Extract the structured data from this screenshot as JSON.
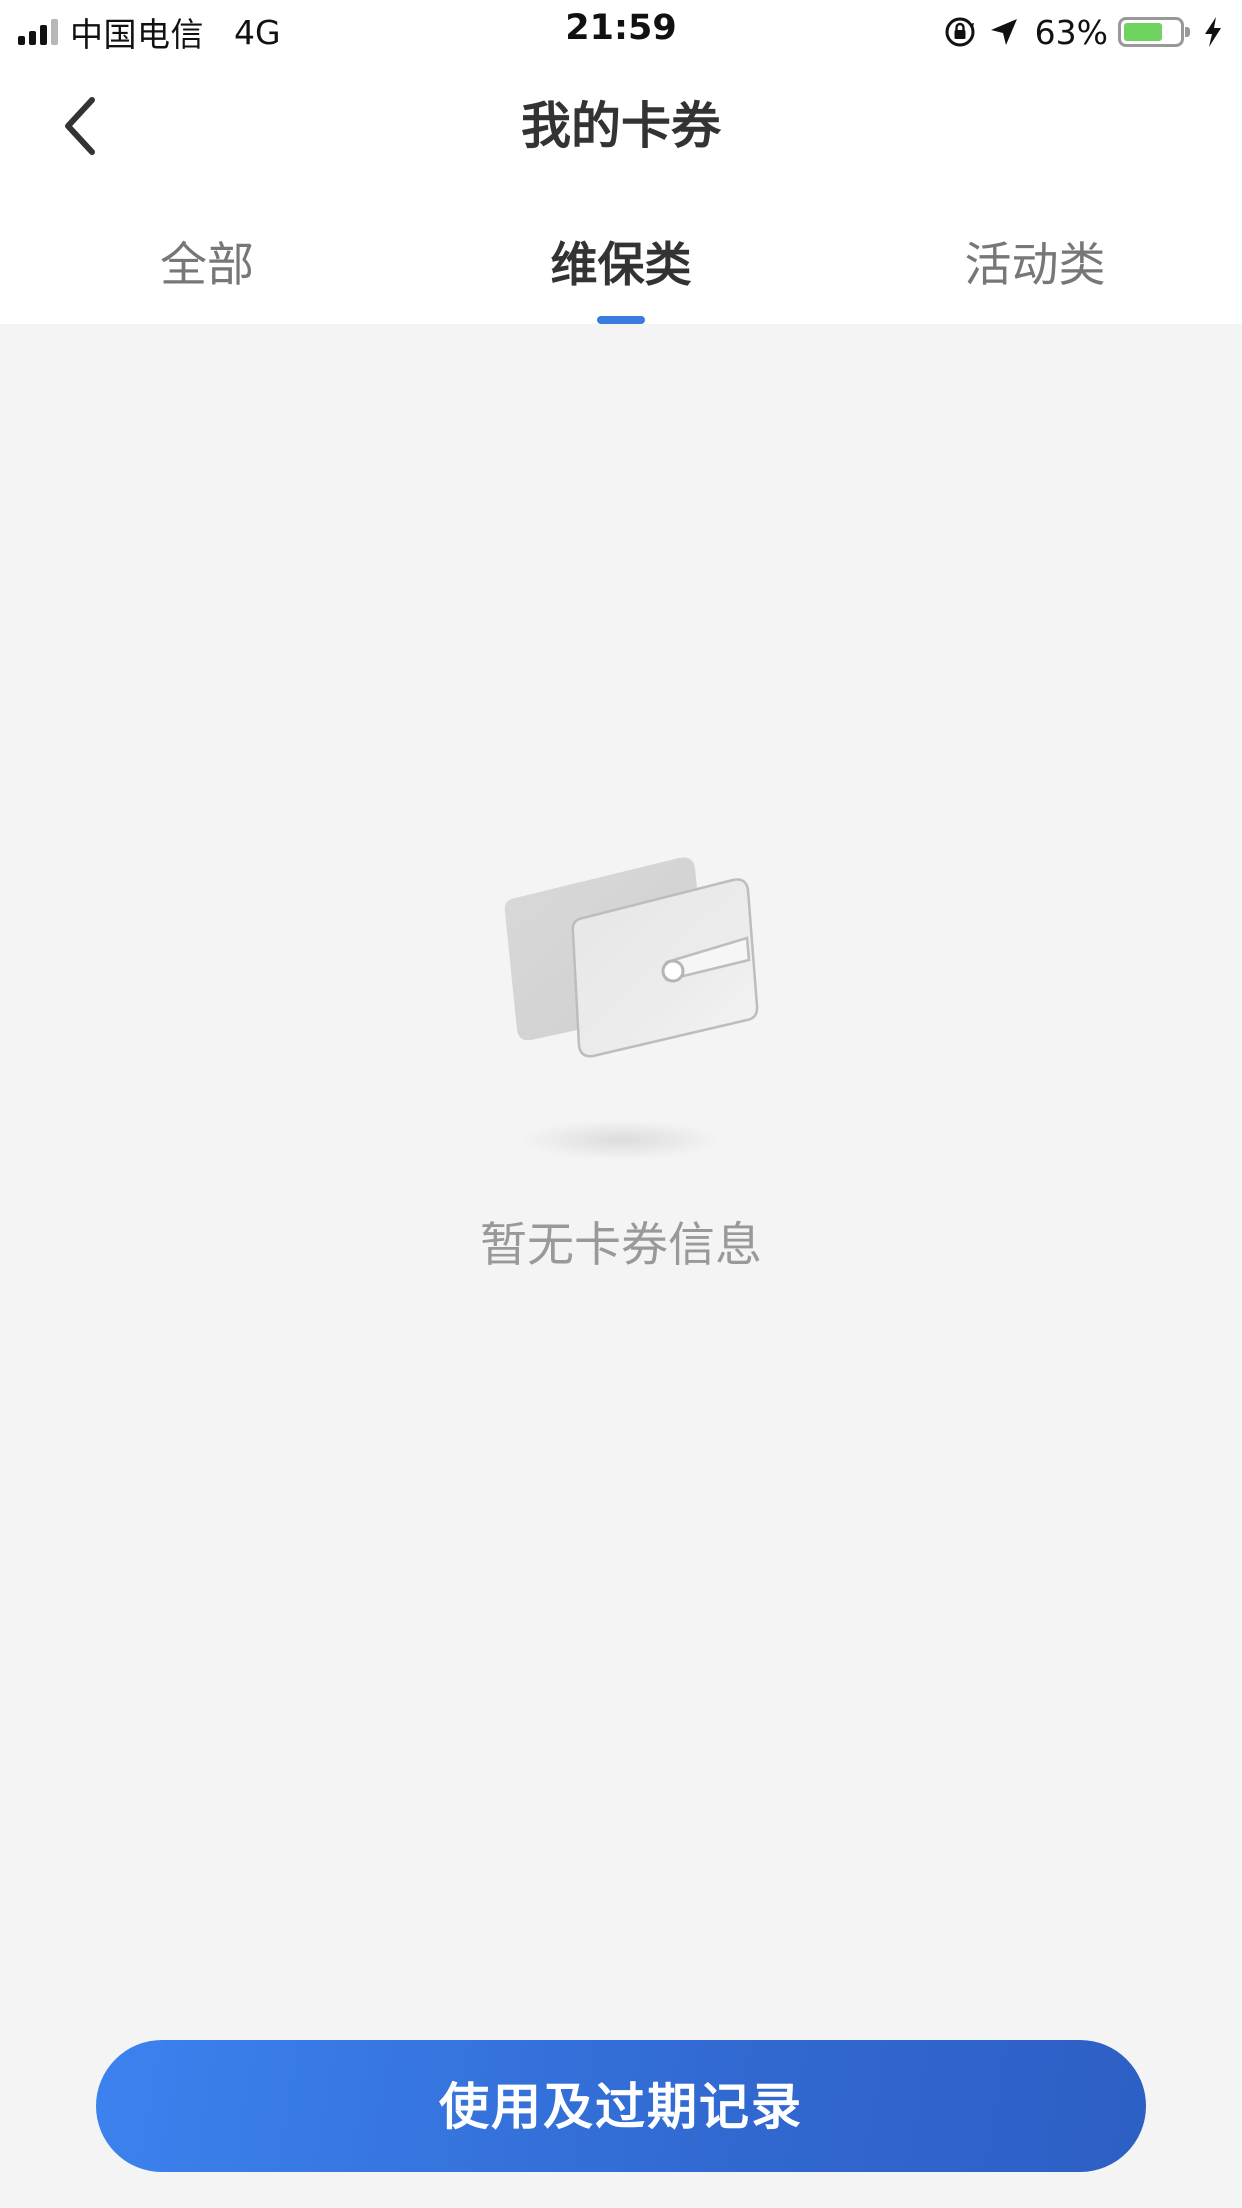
{
  "status_bar": {
    "carrier": "中国电信",
    "network": "4G",
    "time": "21:59",
    "battery_percent": "63%",
    "battery_color": "#6fd35f"
  },
  "nav": {
    "title": "我的卡券",
    "back_icon": "chevron-left-icon"
  },
  "tabs": {
    "items": [
      {
        "label": "全部"
      },
      {
        "label": "维保类"
      },
      {
        "label": "活动类"
      }
    ],
    "active_index": 1,
    "accent_color": "#3a7be0"
  },
  "empty_state": {
    "icon": "wallet-card-icon",
    "message": "暂无卡券信息"
  },
  "footer": {
    "history_button_label": "使用及过期记录",
    "button_color": "#3a7be0"
  }
}
